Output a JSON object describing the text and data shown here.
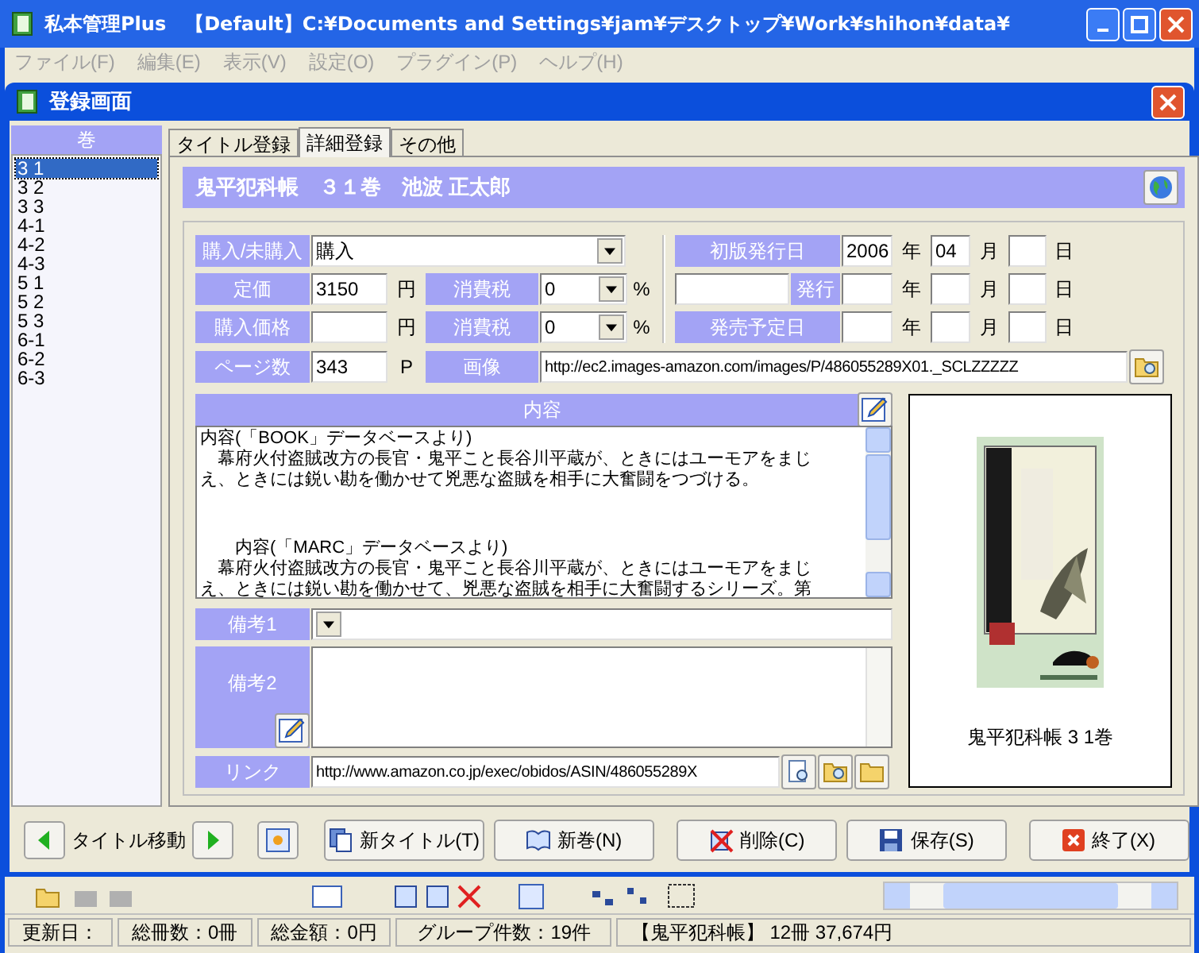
{
  "window": {
    "title": "私本管理Plus　【Default】C:¥Documents and Settings¥jam¥デスクトップ¥Work¥shihon¥data¥"
  },
  "menu": [
    {
      "label": "ファイル(F)"
    },
    {
      "label": "編集(E)"
    },
    {
      "label": "表示(V)"
    },
    {
      "label": "設定(O)"
    },
    {
      "label": "プラグイン(P)"
    },
    {
      "label": "ヘルプ(H)"
    }
  ],
  "dialog": {
    "title": "登録画面"
  },
  "volumes": {
    "header": "巻",
    "items": [
      {
        "label": "3 1",
        "selected": true
      },
      {
        "label": "3 2",
        "selected": false
      },
      {
        "label": "3 3",
        "selected": false
      },
      {
        "label": "4-1",
        "selected": false
      },
      {
        "label": "4-2",
        "selected": false
      },
      {
        "label": "4-3",
        "selected": false
      },
      {
        "label": "5 1",
        "selected": false
      },
      {
        "label": "5 2",
        "selected": false
      },
      {
        "label": "5 3",
        "selected": false
      },
      {
        "label": "6-1",
        "selected": false
      },
      {
        "label": "6-2",
        "selected": false
      },
      {
        "label": "6-3",
        "selected": false
      }
    ]
  },
  "tabs": [
    {
      "label": "タイトル登録",
      "selected": false
    },
    {
      "label": "詳細登録",
      "selected": true
    },
    {
      "label": "その他",
      "selected": false
    }
  ],
  "heading": "鬼平犯科帳　３１巻　池波 正太郎",
  "purchase": {
    "label": "購入/未購入",
    "value": "購入"
  },
  "price_rows": [
    {
      "label": "定価",
      "value": "3150",
      "unit": "円",
      "tax_label": "消費税",
      "tax_value": "0",
      "tax_unit": "%"
    },
    {
      "label": "購入価格",
      "unit": "円",
      "tax_label": "消費税",
      "tax_value": "0",
      "tax_unit": "%"
    }
  ],
  "pages": {
    "label": "ページ数",
    "value": "343",
    "unit": "P"
  },
  "image": {
    "label": "画像",
    "value": "http://ec2.images-amazon.com/images/P/486055289X01._SCLZZZZZ"
  },
  "dates": [
    {
      "kind": "date",
      "label": "初版発行日",
      "year": "2006",
      "month": "04",
      "year_unit": "年",
      "month_unit": "月",
      "day_unit": "日"
    },
    {
      "kind": "issue",
      "label": "発行",
      "year_unit": "年",
      "month_unit": "月",
      "day_unit": "日"
    },
    {
      "kind": "date",
      "label": "発売予定日",
      "year_unit": "年",
      "month_unit": "月",
      "day_unit": "日"
    }
  ],
  "content": {
    "label": "内容",
    "paragraphs": [
      [
        "内容(「BOOK」データベースより)",
        "　幕府火付盗賊改方の長官・鬼平こと長谷川平蔵が、ときにはユーモアをまじ",
        "え、ときには鋭い勘を働かせて兇悪な盗賊を相手に大奮闘をつづける。"
      ],
      [
        "　　内容(「MARC」データベースより)",
        "　幕府火付盗賊改方の長官・鬼平こと長谷川平蔵が、ときにはユーモアをまじ",
        "え、ときには鋭い勘を働かせて、兇悪な盗賊を相手に大奮闘するシリーズ。第"
      ]
    ]
  },
  "remarks1": {
    "label": "備考1"
  },
  "remarks2": {
    "label": "備考2"
  },
  "link": {
    "label": "リンク",
    "value": "http://www.amazon.co.jp/exec/obidos/ASIN/486055289X"
  },
  "cover": {
    "caption": "鬼平犯科帳 3 1巻"
  },
  "navigation": {
    "label": "タイトル移動"
  },
  "actions": [
    {
      "label": "新タイトル(T)",
      "kind": "new-title"
    },
    {
      "label": "新巻(N)",
      "kind": "new-volume"
    },
    {
      "label": "削除(C)",
      "kind": "delete"
    },
    {
      "label": "保存(S)",
      "kind": "save"
    },
    {
      "label": "終了(X)",
      "kind": "close"
    }
  ],
  "status_bar": [
    "更新日：",
    "総冊数：0冊",
    "総金額：0円",
    "グループ件数：19件",
    "【鬼平犯科帳】 12冊  37,674円"
  ]
}
